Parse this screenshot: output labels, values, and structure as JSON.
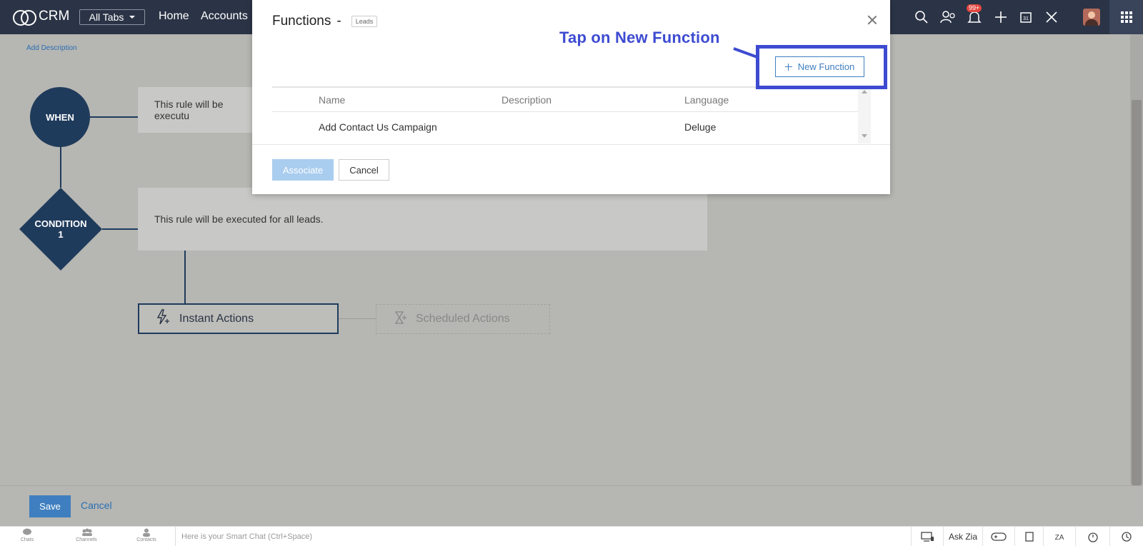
{
  "topnav": {
    "logo_text": "CRM",
    "alltabs_label": "All Tabs",
    "links": [
      "Home",
      "Accounts"
    ],
    "notification_count": "99+"
  },
  "canvas": {
    "add_description": "Add Description",
    "when_label": "WHEN",
    "when_text": "This rule will be executu",
    "condition_label_1": "CONDITION",
    "condition_label_2": "1",
    "condition_text": "This rule will be executed for all leads.",
    "instant_actions": "Instant Actions",
    "scheduled_actions": "Scheduled Actions"
  },
  "bottom": {
    "save_label": "Save",
    "cancel_label": "Cancel"
  },
  "footer": {
    "items": [
      "Chats",
      "Channels",
      "Contacts"
    ],
    "smart_chat_placeholder": "Here is your Smart Chat (Ctrl+Space)",
    "ask_zia": "Ask Zia"
  },
  "modal": {
    "title": "Functions",
    "separator": "-",
    "module_tag": "Leads",
    "new_function_label": "New Function",
    "columns": [
      "Name",
      "Description",
      "Language"
    ],
    "rows": [
      {
        "name": "Add Contact Us Campaign",
        "description": "",
        "language": "Deluge"
      }
    ],
    "associate_label": "Associate",
    "cancel_label": "Cancel"
  },
  "annotation": {
    "text": "Tap on New Function",
    "color": "#3d4bd1"
  },
  "colors": {
    "nav_bg": "#2b3446",
    "node": "#1f3b5c",
    "accent": "#3f7fbf"
  }
}
